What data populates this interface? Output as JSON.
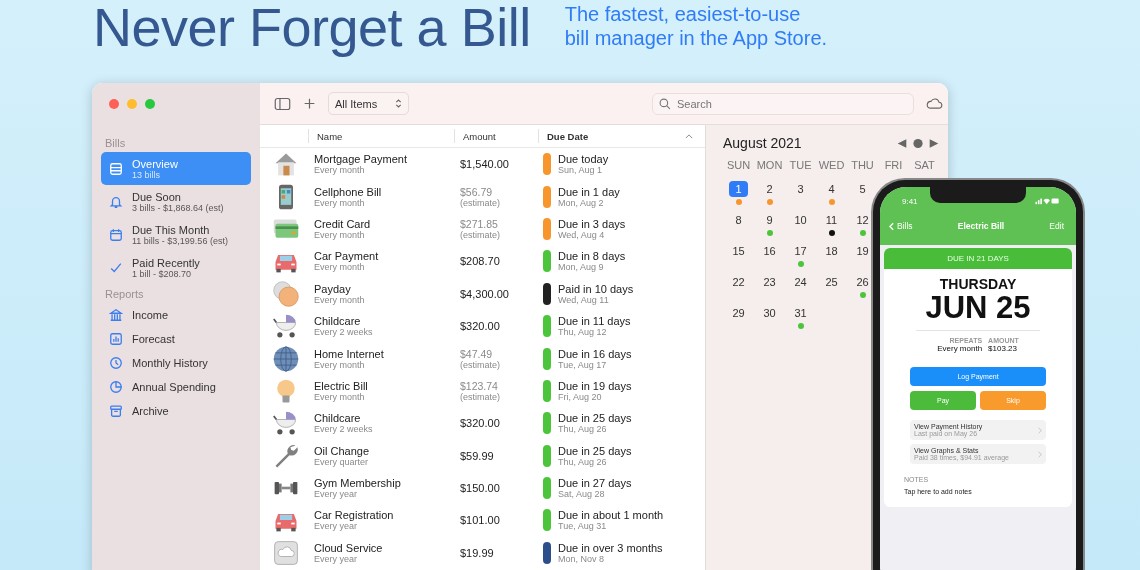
{
  "headline": "Never Forget a Bill",
  "tagline": [
    "The fastest, easiest-to-use",
    "bill manager in the App Store."
  ],
  "toolbar": {
    "filter": "All Items",
    "search": {
      "placeholder": "Search"
    }
  },
  "sidebar": {
    "sections": [
      {
        "title": "Bills",
        "items": [
          {
            "kind": "list",
            "label": "Overview",
            "sub": "13 bills",
            "selected": true
          },
          {
            "kind": "bell",
            "label": "Due Soon",
            "sub": "3 bills - $1,868.64 (est)",
            "selected": false
          },
          {
            "kind": "calendar",
            "label": "Due This Month",
            "sub": "11 bills - $3,199.56 (est)",
            "selected": false
          },
          {
            "kind": "check",
            "label": "Paid Recently",
            "sub": "1 bill - $208.70",
            "selected": false
          }
        ]
      },
      {
        "title": "Reports",
        "items": [
          {
            "kind": "bank",
            "label": "Income",
            "selected": false
          },
          {
            "kind": "chart",
            "label": "Forecast",
            "selected": false
          },
          {
            "kind": "clock",
            "label": "Monthly History",
            "selected": false
          },
          {
            "kind": "pie",
            "label": "Annual Spending",
            "selected": false
          },
          {
            "kind": "archive",
            "label": "Archive",
            "selected": false
          }
        ]
      }
    ]
  },
  "table": {
    "columns": [
      {
        "label": "Name",
        "sorted": false
      },
      {
        "label": "Amount",
        "sorted": false
      },
      {
        "label": "Due Date",
        "sorted": true
      }
    ],
    "rows": [
      {
        "kind": "house",
        "name": "Mortgage Payment",
        "repeat": "Every month",
        "amount": "$1,540.00",
        "estimated": false,
        "due": "Due today",
        "date": "Sun, Aug 1",
        "color": "#f7962d"
      },
      {
        "kind": "phone",
        "name": "Cellphone Bill",
        "repeat": "Every month",
        "amount": "$56.79",
        "estimated": true,
        "note": "(estimate)",
        "due": "Due in 1 day",
        "date": "Mon, Aug 2",
        "color": "#f7962d"
      },
      {
        "kind": "card",
        "name": "Credit Card",
        "repeat": "Every month",
        "amount": "$271.85",
        "estimated": true,
        "note": "(estimate)",
        "due": "Due in 3 days",
        "date": "Wed, Aug 4",
        "color": "#f7962d"
      },
      {
        "kind": "car",
        "name": "Car Payment",
        "repeat": "Every month",
        "amount": "$208.70",
        "estimated": false,
        "due": "Due in 8 days",
        "date": "Mon, Aug 9",
        "color": "#4cc53c"
      },
      {
        "kind": "coins",
        "name": "Payday",
        "repeat": "Every month",
        "amount": "$4,300.00",
        "estimated": false,
        "due": "Paid in 10 days",
        "date": "Wed, Aug 11",
        "color": "#222222"
      },
      {
        "kind": "stroller",
        "name": "Childcare",
        "repeat": "Every 2 weeks",
        "amount": "$320.00",
        "estimated": false,
        "due": "Due in 11 days",
        "date": "Thu, Aug 12",
        "color": "#4cc53c"
      },
      {
        "kind": "globe",
        "name": "Home Internet",
        "repeat": "Every month",
        "amount": "$47.49",
        "estimated": true,
        "note": "(estimate)",
        "due": "Due in 16 days",
        "date": "Tue, Aug 17",
        "color": "#4cc53c"
      },
      {
        "kind": "bulb",
        "name": "Electric Bill",
        "repeat": "Every month",
        "amount": "$123.74",
        "estimated": true,
        "note": "(estimate)",
        "due": "Due in 19 days",
        "date": "Fri, Aug 20",
        "color": "#4cc53c"
      },
      {
        "kind": "stroller",
        "name": "Childcare",
        "repeat": "Every 2 weeks",
        "amount": "$320.00",
        "estimated": false,
        "due": "Due in 25 days",
        "date": "Thu, Aug 26",
        "color": "#4cc53c"
      },
      {
        "kind": "wrench",
        "name": "Oil Change",
        "repeat": "Every quarter",
        "amount": "$59.99",
        "estimated": false,
        "due": "Due in 25 days",
        "date": "Thu, Aug 26",
        "color": "#4cc53c"
      },
      {
        "kind": "dumbbell",
        "name": "Gym Membership",
        "repeat": "Every year",
        "amount": "$150.00",
        "estimated": false,
        "due": "Due in 27 days",
        "date": "Sat, Aug 28",
        "color": "#4cc53c"
      },
      {
        "kind": "car",
        "name": "Car Registration",
        "repeat": "Every year",
        "amount": "$101.00",
        "estimated": false,
        "due": "Due in about 1 month",
        "date": "Tue, Aug 31",
        "color": "#4cc53c"
      },
      {
        "kind": "cloud",
        "name": "Cloud Service",
        "repeat": "Every year",
        "amount": "$19.99",
        "estimated": false,
        "due": "Due in over 3 months",
        "date": "Mon, Nov 8",
        "color": "#2c4f8c"
      }
    ]
  },
  "calendar": {
    "month": "August 2021",
    "weekdays": [
      "SUN",
      "MON",
      "TUE",
      "WED",
      "THU",
      "FRI",
      "SAT"
    ],
    "weeks": [
      [
        {
          "day": "1",
          "selected": true,
          "color": "#f7962d"
        },
        {
          "day": "2",
          "selected": false,
          "color": "#f7962d"
        },
        {
          "day": "3",
          "selected": false
        },
        {
          "day": "4",
          "selected": false,
          "color": "#f7962d"
        },
        {
          "day": "5",
          "selected": false
        }
      ],
      [
        {
          "day": "8",
          "selected": false
        },
        {
          "day": "9",
          "selected": false,
          "color": "#4cc53c"
        },
        {
          "day": "10",
          "selected": false
        },
        {
          "day": "11",
          "selected": false,
          "color": "#111111"
        },
        {
          "day": "12",
          "selected": false,
          "color": "#4cc53c"
        }
      ],
      [
        {
          "day": "15",
          "selected": false
        },
        {
          "day": "16",
          "selected": false
        },
        {
          "day": "17",
          "selected": false,
          "color": "#4cc53c"
        },
        {
          "day": "18",
          "selected": false
        },
        {
          "day": "19",
          "selected": false
        }
      ],
      [
        {
          "day": "22",
          "selected": false
        },
        {
          "day": "23",
          "selected": false
        },
        {
          "day": "24",
          "selected": false
        },
        {
          "day": "25",
          "selected": false
        },
        {
          "day": "26",
          "selected": false,
          "color": "#4cc53c"
        }
      ],
      [
        {
          "day": "29",
          "selected": false
        },
        {
          "day": "30",
          "selected": false
        },
        {
          "day": "31",
          "selected": false,
          "color": "#4cc53c"
        }
      ]
    ]
  },
  "phone": {
    "time": "9:41",
    "back": "Bills",
    "title": "Electric Bill",
    "edit": "Edit",
    "banner": "DUE IN 21 DAYS",
    "weekday": "THURSDAY",
    "date": "JUN 25",
    "facts": [
      {
        "label": "REPEATS",
        "value": "Every month"
      },
      {
        "label": "AMOUNT",
        "value": "$103.23"
      }
    ],
    "log": "Log Payment",
    "pay": "Pay",
    "skip": "Skip",
    "links": [
      {
        "title": "View Payment History",
        "sub": "Last paid on May 26"
      },
      {
        "title": "View Graphs & Stats",
        "sub": "Paid 38 times, $94.91 average"
      }
    ],
    "notes_label": "NOTES",
    "notes": "Tap here to add notes"
  }
}
